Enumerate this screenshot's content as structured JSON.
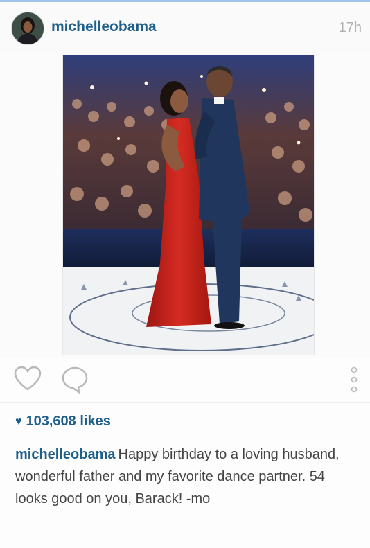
{
  "post": {
    "username": "michelleobama",
    "timestamp": "17h",
    "photo_icon": "photo-image",
    "actions": {
      "like_icon": "heart-outline-icon",
      "comment_icon": "comment-bubble-icon",
      "more_icon": "more-vertical-icon"
    },
    "likes_text": "103,608 likes",
    "caption_user": "michelleobama",
    "caption_text": "Happy birthday to a loving husband, wonderful father and my favorite dance partner. 54 looks good on you, Barack! -mo",
    "colors": {
      "accent": "#1f5f8b",
      "timestamp": "#b0b0b0",
      "dress": "#c9231c",
      "suit": "#20365d"
    }
  }
}
